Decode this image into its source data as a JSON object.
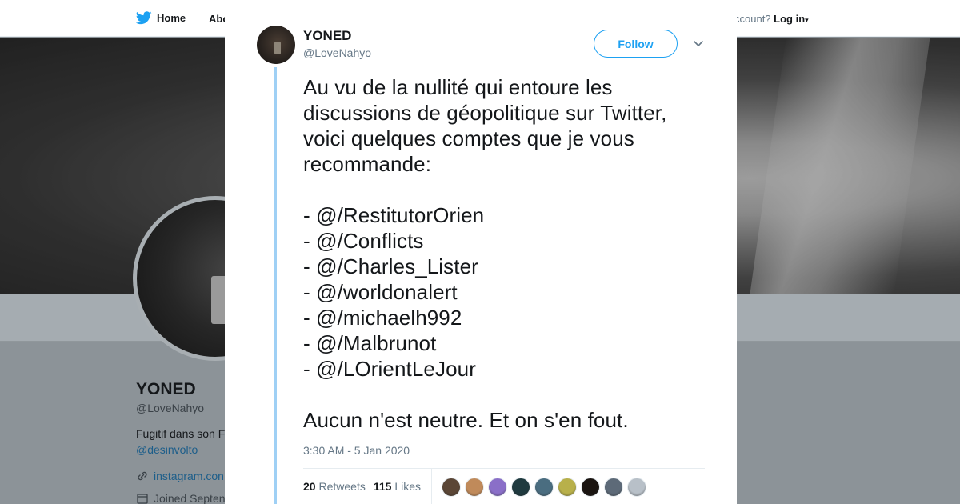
{
  "nav": {
    "home_label": "Home",
    "about_label": "Abo",
    "account_prompt": "ccount?",
    "login_label": "Log in"
  },
  "profile": {
    "name": "YONED",
    "handle": "@LoveNahyo",
    "bio": "Fugitif dans son F",
    "bio_link": "@desinvolto",
    "website": "instagram.con",
    "joined": "Joined Septen"
  },
  "tweet": {
    "author_name": "YONED",
    "author_handle": "@LoveNahyo",
    "follow_label": "Follow",
    "lines": [
      "Au vu de la nullité qui entoure les",
      "discussions de géopolitique sur Twitter,",
      "voici quelques comptes que je vous",
      "recommande:",
      "",
      "- @/RestitutorOrien",
      "- @/Conflicts",
      "- @/Charles_Lister",
      "- @/worldonalert",
      "- @/michaelh992",
      "- @/Malbrunot",
      "- @/LOrientLeJour",
      "",
      "Aucun n'est neutre. Et on s'en fout."
    ],
    "timestamp": "3:30 AM - 5 Jan 2020",
    "retweets_count": "20",
    "retweets_label": "Retweets",
    "likes_count": "115",
    "likes_label": "Likes",
    "liker_colors": [
      "#5b4636",
      "#c08a5a",
      "#8a6fc8",
      "#1f3a3f",
      "#4a6d80",
      "#b8b04a",
      "#1a1410",
      "#5d6a78",
      "#b8c0c8"
    ]
  },
  "colors": {
    "accent": "#1da1f2",
    "thread": "#9fd0f5"
  },
  "icons": {
    "nav_home": "twitter-bird-icon",
    "close": "close-icon",
    "caret": "chevron-down-icon"
  }
}
